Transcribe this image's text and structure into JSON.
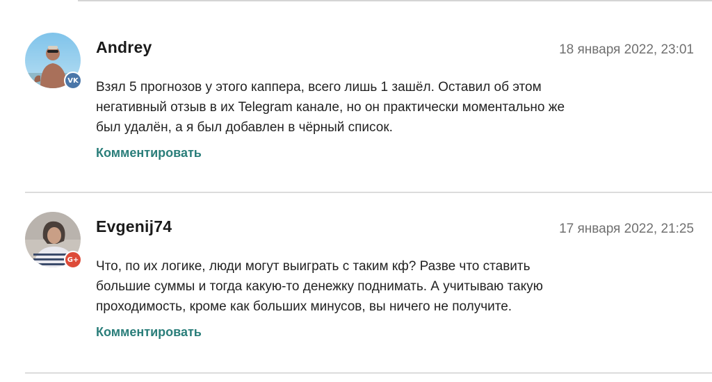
{
  "comments": [
    {
      "author": "Andrey",
      "date": "18 января 2022, 23:01",
      "social_icon": "vk-icon",
      "social_label": "VK",
      "text_lines": [
        "Взял 5 прогнозов у этого каппера, всего лишь 1 зашёл. Оставил об этом",
        "негативный отзыв в их Telegram канале, но он практически моментально же",
        "был удалён, а я был добавлен в чёрный список."
      ],
      "reply_label": "Комментировать"
    },
    {
      "author": "Evgenij74",
      "date": "17 января 2022, 21:25",
      "social_icon": "google-plus-icon",
      "social_label": "G+",
      "text_lines": [
        "Что, по их логике, люди могут выиграть с таким кф? Разве что ставить",
        "большие суммы и тогда какую-то денежку поднимать. А учитываю такую",
        "проходимость, кроме как больших минусов, вы ничего не получите."
      ],
      "reply_label": "Комментировать"
    }
  ],
  "colors": {
    "reply_link": "#2a7e7a",
    "date_text": "#707070",
    "divider": "#dcdcdc",
    "vk_badge": "#4a76a8",
    "gplus_badge": "#dd4b39"
  }
}
